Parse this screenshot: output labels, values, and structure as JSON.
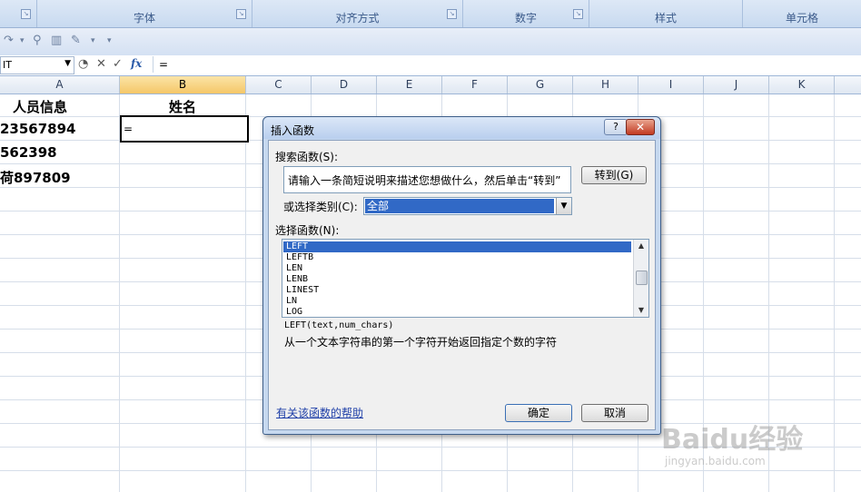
{
  "ribbon": {
    "groups": [
      "字体",
      "对齐方式",
      "数字",
      "样式",
      "单元格"
    ]
  },
  "formula_bar": {
    "name_box": "IT",
    "cancel_icon": "✕",
    "enter_icon": "✓",
    "fx": "fx",
    "content": "="
  },
  "columns": [
    "A",
    "B",
    "C",
    "D",
    "E",
    "F",
    "G",
    "H",
    "I",
    "J",
    "K"
  ],
  "sheet": {
    "a1": "人员信息",
    "b1": "姓名",
    "a2": "23567894",
    "b2": "=",
    "a3": "562398",
    "a4": "荷897809"
  },
  "dialog": {
    "title": "插入函数",
    "help_button": "?",
    "close_button": "✕",
    "search_label": "搜索函数(S):",
    "search_value": "请输入一条简短说明来描述您想做什么，然后单击“转到”",
    "go_button": "转到(G)",
    "category_label": "或选择类别(C):",
    "category_value": "全部",
    "function_label": "选择函数(N):",
    "functions": [
      "LEFT",
      "LEFTB",
      "LEN",
      "LENB",
      "LINEST",
      "LN",
      "LOG"
    ],
    "selected_function": "LEFT",
    "syntax": "LEFT(text,num_chars)",
    "description": "从一个文本字符串的第一个字符开始返回指定个数的字符",
    "help_link": "有关该函数的帮助",
    "ok_button": "确定",
    "cancel_button": "取消"
  },
  "watermark": {
    "brand": "Baidu经验",
    "url": "jingyan.baidu.com"
  }
}
